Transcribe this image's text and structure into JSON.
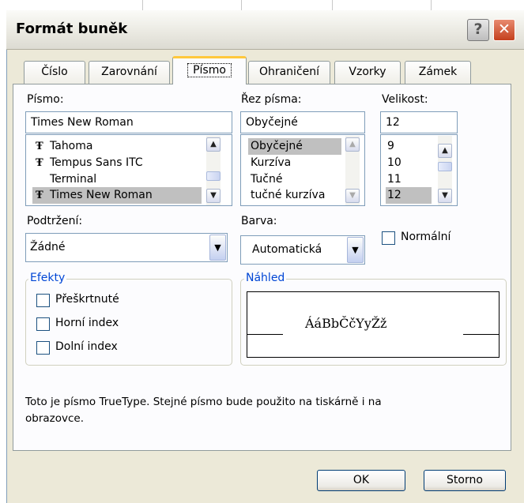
{
  "window": {
    "title": "Formát buněk"
  },
  "tabs": [
    "Číslo",
    "Zarovnání",
    "Písmo",
    "Ohraničení",
    "Vzorky",
    "Zámek"
  ],
  "font": {
    "label": "Písmo:",
    "value": "Times New Roman",
    "items": [
      "Tahoma",
      "Tempus Sans ITC",
      "Terminal",
      "Times New Roman"
    ]
  },
  "style": {
    "label": "Řez písma:",
    "value": "Obyčejné",
    "items": [
      "Obyčejné",
      "Kurzíva",
      "Tučné",
      "tučné kurzíva"
    ]
  },
  "size": {
    "label": "Velikost:",
    "value": "12",
    "items": [
      "9",
      "10",
      "11",
      "12"
    ]
  },
  "underline": {
    "label": "Podtržení:",
    "value": "Žádné"
  },
  "color": {
    "label": "Barva:",
    "value": "Automatická"
  },
  "normal": {
    "label": "Normální",
    "checked": false
  },
  "effects": {
    "title": "Efekty",
    "strike": "Přeškrtnuté",
    "superscript": "Horní index",
    "subscript": "Dolní index"
  },
  "preview": {
    "title": "Náhled",
    "sample": "ÁáBbČčYyŽž"
  },
  "info": {
    "line1": "Toto je písmo TrueType. Stejné písmo bude použito na tiskárně i na",
    "line2": "obrazovce."
  },
  "buttons": {
    "ok": "OK",
    "cancel": "Storno"
  },
  "icons": {
    "truetype": "Ŧ"
  }
}
